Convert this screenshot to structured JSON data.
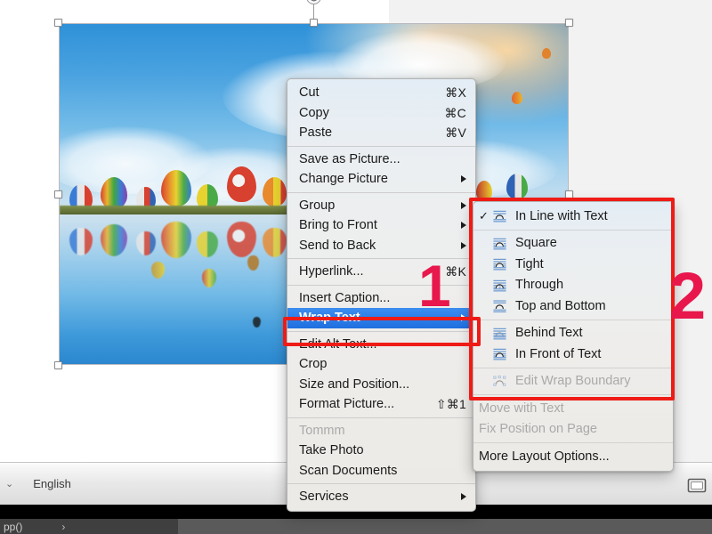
{
  "app": {
    "platform": "macOS",
    "status_bar": {
      "language": "English",
      "language_caret": "⌄",
      "view_icon": "print-layout-view-icon"
    },
    "taskbar": {
      "tab_label": "pp()",
      "tab_caret": "›"
    }
  },
  "picture": {
    "name": "hot-air-balloons-photo",
    "alt": "Colorful hot air balloons over water with reflections",
    "selected": true,
    "handles": [
      "top-left",
      "top-center",
      "top-right",
      "middle-left",
      "middle-right",
      "bottom-left",
      "bottom-center",
      "bottom-right"
    ],
    "rotate_handle": "rotate-handle"
  },
  "context_menu": {
    "name": "picture-context-menu",
    "groups": [
      {
        "items": [
          {
            "label": "Cut",
            "shortcut": "⌘X",
            "type": "item"
          },
          {
            "label": "Copy",
            "shortcut": "⌘C",
            "type": "item"
          },
          {
            "label": "Paste",
            "shortcut": "⌘V",
            "type": "item"
          }
        ]
      },
      {
        "items": [
          {
            "label": "Save as Picture...",
            "shortcut": "",
            "type": "item"
          },
          {
            "label": "Change Picture",
            "shortcut": "",
            "type": "submenu"
          }
        ]
      },
      {
        "items": [
          {
            "label": "Group",
            "shortcut": "",
            "type": "submenu"
          },
          {
            "label": "Bring to Front",
            "shortcut": "",
            "type": "submenu"
          },
          {
            "label": "Send to Back",
            "shortcut": "",
            "type": "submenu"
          }
        ]
      },
      {
        "items": [
          {
            "label": "Hyperlink...",
            "shortcut": "⌘K",
            "type": "item"
          }
        ]
      },
      {
        "items": [
          {
            "label": "Insert Caption...",
            "shortcut": "",
            "type": "item"
          },
          {
            "label": "Wrap Text",
            "shortcut": "",
            "type": "submenu",
            "highlighted": true
          }
        ]
      },
      {
        "items": [
          {
            "label": "Edit Alt Text...",
            "shortcut": "",
            "type": "item"
          },
          {
            "label": "Crop",
            "shortcut": "",
            "type": "item"
          },
          {
            "label": "Size and Position...",
            "shortcut": "",
            "type": "item"
          },
          {
            "label": "Format Picture...",
            "shortcut": "⇧⌘1",
            "type": "item"
          }
        ]
      },
      {
        "items": [
          {
            "label": "Tommm",
            "shortcut": "",
            "type": "item",
            "disabled": true
          },
          {
            "label": "Take Photo",
            "shortcut": "",
            "type": "item"
          },
          {
            "label": "Scan Documents",
            "shortcut": "",
            "type": "item"
          }
        ]
      },
      {
        "items": [
          {
            "label": "Services",
            "shortcut": "",
            "type": "submenu"
          }
        ]
      }
    ]
  },
  "wrap_submenu": {
    "name": "wrap-text-submenu",
    "groups": [
      {
        "items": [
          {
            "label": "In Line with Text",
            "icon": "wrap-inline-icon",
            "checked": true
          }
        ]
      },
      {
        "items": [
          {
            "label": "Square",
            "icon": "wrap-square-icon",
            "checked": false
          },
          {
            "label": "Tight",
            "icon": "wrap-tight-icon",
            "checked": false
          },
          {
            "label": "Through",
            "icon": "wrap-through-icon",
            "checked": false
          },
          {
            "label": "Top and Bottom",
            "icon": "wrap-topbottom-icon",
            "checked": false
          }
        ]
      },
      {
        "items": [
          {
            "label": "Behind Text",
            "icon": "wrap-behind-icon",
            "checked": false
          },
          {
            "label": "In Front of Text",
            "icon": "wrap-infront-icon",
            "checked": false
          }
        ]
      },
      {
        "items": [
          {
            "label": "Edit Wrap Boundary",
            "icon": "wrap-boundary-icon",
            "checked": false,
            "disabled": true
          }
        ]
      },
      {
        "items": [
          {
            "label": "Move with Text",
            "icon": "",
            "checked": false,
            "disabled": true
          },
          {
            "label": "Fix Position on Page",
            "icon": "",
            "checked": false,
            "disabled": true
          }
        ]
      },
      {
        "items": [
          {
            "label": "More Layout Options...",
            "icon": "",
            "checked": false
          }
        ]
      }
    ],
    "checkmark": "✓"
  },
  "annotations": {
    "accent_color": "#ef1b16",
    "number_color": "#e8174c",
    "step_1": "1",
    "step_2": "2",
    "boxes": [
      {
        "name": "wrap-text-callout",
        "target": "Wrap Text"
      },
      {
        "name": "wrap-options-callout",
        "target": "wrap style options"
      }
    ]
  }
}
